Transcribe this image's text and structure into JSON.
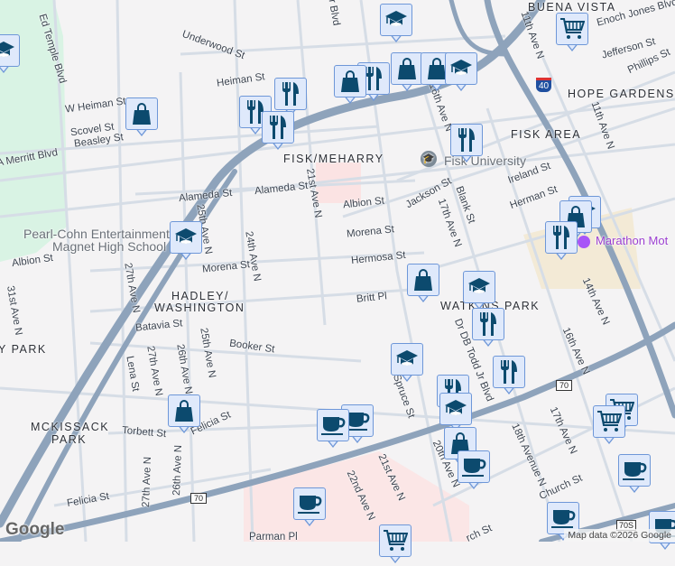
{
  "map": {
    "streets": {
      "ed_temple": "Ed Temple Blvd",
      "underwood": "Underwood St",
      "heiman": "Heiman St",
      "w_heiman": "W Heiman St",
      "scovel": "Scovel St",
      "beasley": "Beasley St",
      "merritt": "A Merritt Blvd",
      "ave21": "21st Ave N",
      "alameda1": "Alameda St",
      "alameda2": "Alameda St",
      "albion1": "Albion St",
      "albion2": "Albion St",
      "ave25a": "25th Ave N",
      "ave24": "24th Ave N",
      "morena1": "Morena St",
      "morena2": "Morena St",
      "hermosa": "Hermosa St",
      "britt": "Britt Pl",
      "batavia": "Batavia St",
      "booker": "Booker St",
      "ave31": "31st Ave N",
      "ave27a": "27th Ave N",
      "ave27b": "27th Ave N",
      "ave27c": "27th Ave N",
      "lena": "Lena St",
      "ave26a": "26th Ave N",
      "ave26b": "26th Ave N",
      "ave25b": "25th Ave N",
      "torbett": "Torbett St",
      "felicia1": "Felicia St",
      "felicia2": "Felicia St",
      "jackson": "Jackson St",
      "blank": "Blank St",
      "ave17a": "17th Ave N",
      "ireland": "Ireland St",
      "herman": "Herman St",
      "ave11a": "11th Ave N",
      "ave11b": "11th Ave N",
      "jefferson": "Jefferson St",
      "phillips": "Phillips St",
      "enoch": "Enoch Jones Blvd",
      "ave16a": "16th Ave N",
      "ave14": "14th Ave N",
      "dbtodd": "Dr DB Todd Jr Blvd",
      "spruce": "Spruce St",
      "ave20": "20th Ave N",
      "ave21b": "21st Ave N",
      "ave22": "22nd Ave N",
      "ave18": "18th Avenue N",
      "ave17b": "17th Ave N",
      "ave16b": "16th Ave N",
      "church1": "Church St",
      "church2": "rch St",
      "jrblvd": "Jr Blvd",
      "parman": "Parman Pl"
    },
    "areas": {
      "fisk_meharry": "FISK/MEHARRY",
      "hadley1": "HADLEY/",
      "hadley2": "WASHINGTON",
      "y_park": "Y PARK",
      "mckissack1": "MCKISSACK",
      "mckissack2": "PARK",
      "fisk_area": "FISK AREA",
      "hope_gardens": "HOPE GARDENS",
      "watkins": "WATKINS PARK",
      "buena_vista": "BUENA VISTA"
    },
    "pois": {
      "pearl1": "Pearl-Cohn Entertainment",
      "pearl2": "Magnet High School",
      "fisk_univ": "Fisk University",
      "marathon": "Marathon Mot"
    },
    "shields": {
      "i40": "40",
      "us70a": "70",
      "us70b": "70",
      "us70s": "70S"
    },
    "attribution": "Map data ©2026 Google",
    "logo": "Google"
  },
  "colors": {
    "highway": "#8ea3bb",
    "road": "#d6dde6",
    "park": "#cdeedd",
    "marker_bg": "#dfe9fb",
    "marker_icon": "#0c4a6e"
  }
}
